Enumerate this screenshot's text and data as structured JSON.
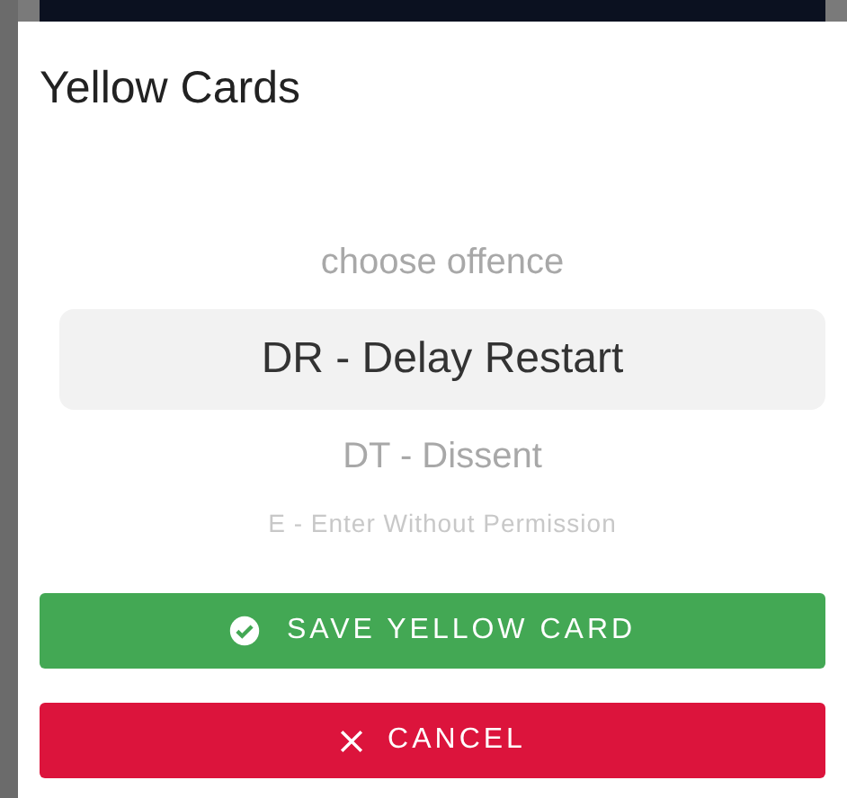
{
  "dialog": {
    "title": "Yellow Cards"
  },
  "picker": {
    "items": [
      {
        "label": "choose offence",
        "selected": false
      },
      {
        "label": "DR - Delay Restart",
        "selected": true
      },
      {
        "label": "DT - Dissent",
        "selected": false
      },
      {
        "label": "E - Enter Without Permission",
        "selected": false
      }
    ]
  },
  "buttons": [
    {
      "kind": "save",
      "label": "SAVE YELLOW CARD"
    },
    {
      "kind": "cancel",
      "label": "CANCEL"
    }
  ]
}
